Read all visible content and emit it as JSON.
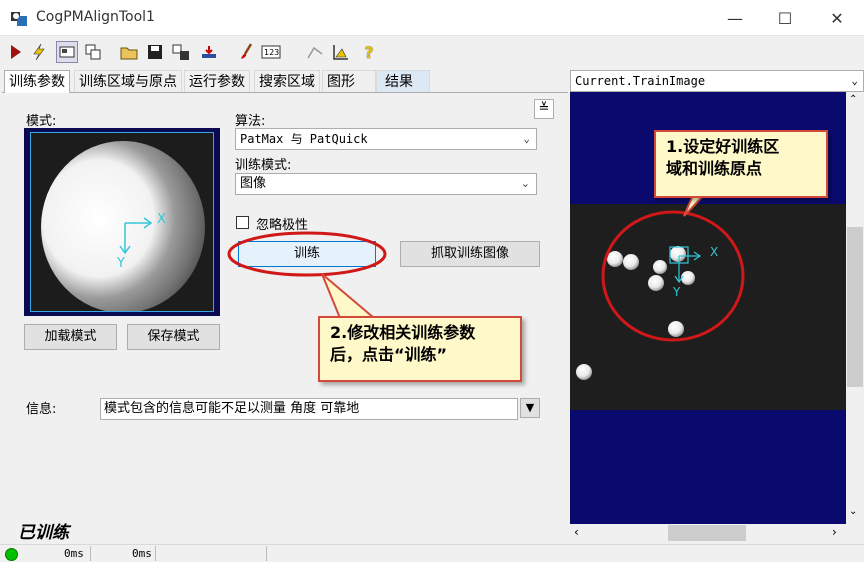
{
  "window": {
    "title": "CogPMAlignTool1",
    "controls": {
      "minimize": "—",
      "maximize": "☐",
      "close": "✕"
    }
  },
  "toolbar": {
    "icons": [
      "run-icon",
      "lightning-icon",
      "image-icon",
      "copy-icon",
      "open-folder-icon",
      "save-icon",
      "import-icon",
      "reset-icon",
      "brush-icon",
      "counter-123-icon",
      "draw-icon",
      "ruler-icon",
      "help-icon"
    ]
  },
  "tabs": [
    {
      "label": "训练参数",
      "active": true
    },
    {
      "label": "训练区域与原点"
    },
    {
      "label": "运行参数"
    },
    {
      "label": "搜索区域"
    },
    {
      "label": "图形"
    },
    {
      "label": "结果"
    }
  ],
  "panel": {
    "mode_label": "模式:",
    "collapse_glyph": "≚",
    "algorithm_label": "算法:",
    "algorithm_value": "PatMax 与 PatQuick",
    "train_mode_label": "训练模式:",
    "train_mode_value": "图像",
    "ignore_polarity_label": "忽略极性",
    "train_button": "训练",
    "grab_train_image_button": "抓取训练图像",
    "load_pattern_button": "加载模式",
    "save_pattern_button": "保存模式",
    "info_label": "信息:",
    "info_value": "模式包含的信息可能不足以测量 角度 可靠地",
    "trained_status": "已训练",
    "axis_x": "X",
    "axis_y": "Y"
  },
  "annotations": {
    "callout1": "1.设定好训练区\n域和训练原点",
    "callout2": "2.修改相关训练参数\n后，点击“训练”"
  },
  "display": {
    "selector_value": "Current.TrainImage",
    "axis_x": "X",
    "axis_y": "Y"
  },
  "statusbar": {
    "time1": "0ms",
    "time2": "0ms",
    "indicator_color": "#00c000"
  }
}
